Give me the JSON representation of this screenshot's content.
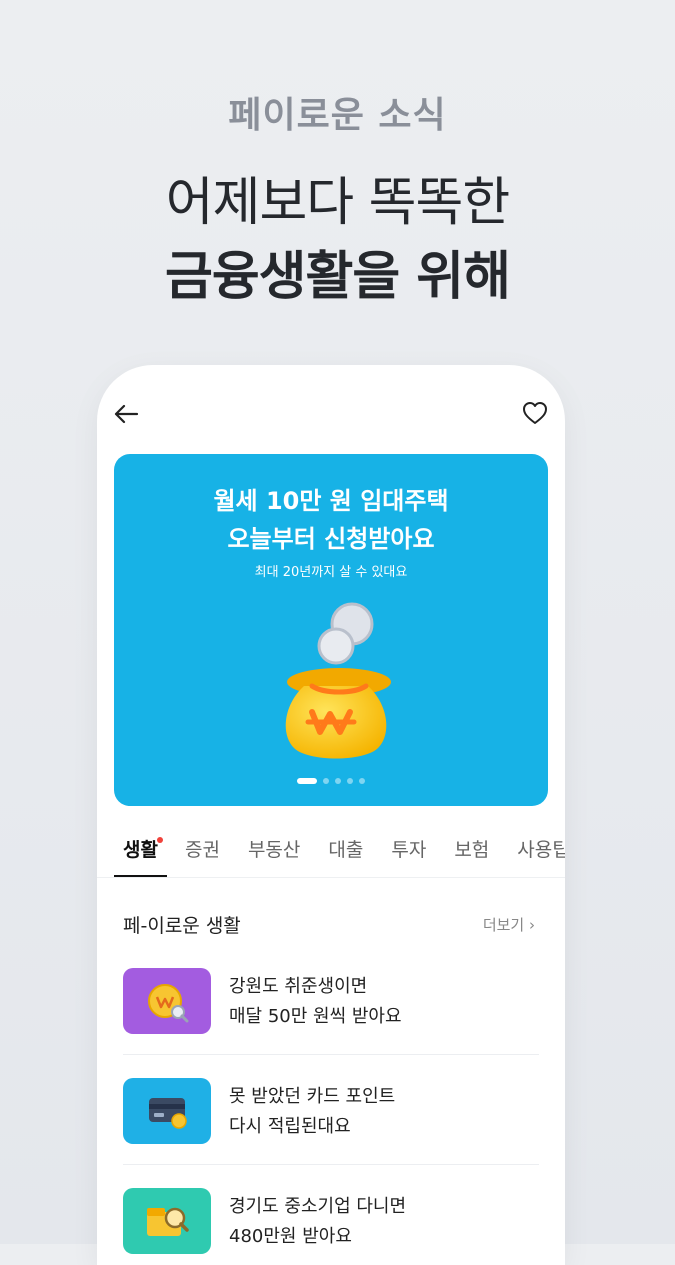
{
  "hero": {
    "subtitle": "페이로운 소식",
    "line1": "어제보다 똑똑한",
    "line2": "금융생활을 위해"
  },
  "topbar": {
    "back_icon": "arrow-left-icon",
    "favorite_icon": "heart-icon"
  },
  "banner": {
    "title_line1": "월세 10만 원 임대주택",
    "title_line2": "오늘부터 신청받아요",
    "subtitle": "최대 20년까지 살 수 있대요",
    "background": "#17b2e6",
    "carousel": {
      "current": 1,
      "total": 5
    }
  },
  "tabs": [
    {
      "label": "생활",
      "active": true,
      "has_new": true
    },
    {
      "label": "증권"
    },
    {
      "label": "부동산"
    },
    {
      "label": "대출"
    },
    {
      "label": "투자"
    },
    {
      "label": "보험"
    },
    {
      "label": "사용팁"
    }
  ],
  "section": {
    "title": "페-이로운 생활",
    "more_label": "더보기 ›"
  },
  "articles": [
    {
      "line1": "강원도 취준생이면",
      "line2": "매달 50만 원씩 받아요",
      "thumb_color": "#a35ce0",
      "icon": "coin-magnifier-icon"
    },
    {
      "line1": "못 받았던 카드 포인트",
      "line2": "다시 적립된대요",
      "thumb_color": "#1fb0e6",
      "icon": "credit-card-icon"
    },
    {
      "line1": "경기도 중소기업 다니면",
      "line2": "480만원 받아요",
      "thumb_color": "#2fcab0",
      "icon": "wallet-magnifier-icon"
    }
  ]
}
